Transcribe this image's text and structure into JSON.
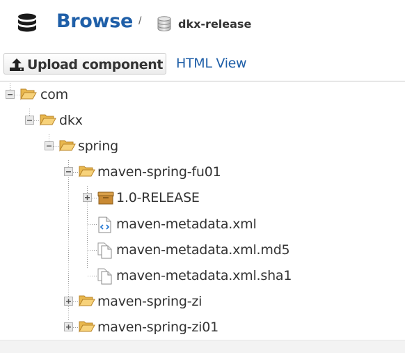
{
  "header": {
    "title": "Browse",
    "separator": "/",
    "repository": "dkx-release",
    "icon": "database-icon",
    "repository_icon": "repository-icon"
  },
  "toolbar": {
    "upload_label": "Upload component",
    "upload_icon": "upload-icon",
    "html_view_label": "HTML View"
  },
  "tree": {
    "nodes": [
      {
        "label": "com",
        "level": 0,
        "type": "folder",
        "expanded": true
      },
      {
        "label": "dkx",
        "level": 1,
        "type": "folder",
        "expanded": true
      },
      {
        "label": "spring",
        "level": 2,
        "type": "folder",
        "expanded": true
      },
      {
        "label": "maven-spring-fu01",
        "level": 3,
        "type": "folder",
        "expanded": true
      },
      {
        "label": "1.0-RELEASE",
        "level": 4,
        "type": "component",
        "expanded": false
      },
      {
        "label": "maven-metadata.xml",
        "level": 4,
        "type": "xml-file"
      },
      {
        "label": "maven-metadata.xml.md5",
        "level": 4,
        "type": "file"
      },
      {
        "label": "maven-metadata.xml.sha1",
        "level": 4,
        "type": "file"
      },
      {
        "label": "maven-spring-zi",
        "level": 3,
        "type": "folder",
        "expanded": false
      },
      {
        "label": "maven-spring-zi01",
        "level": 3,
        "type": "folder",
        "expanded": false
      }
    ]
  },
  "colors": {
    "link": "#1f5fa8",
    "folder": "#f5c86a",
    "text": "#333333"
  }
}
